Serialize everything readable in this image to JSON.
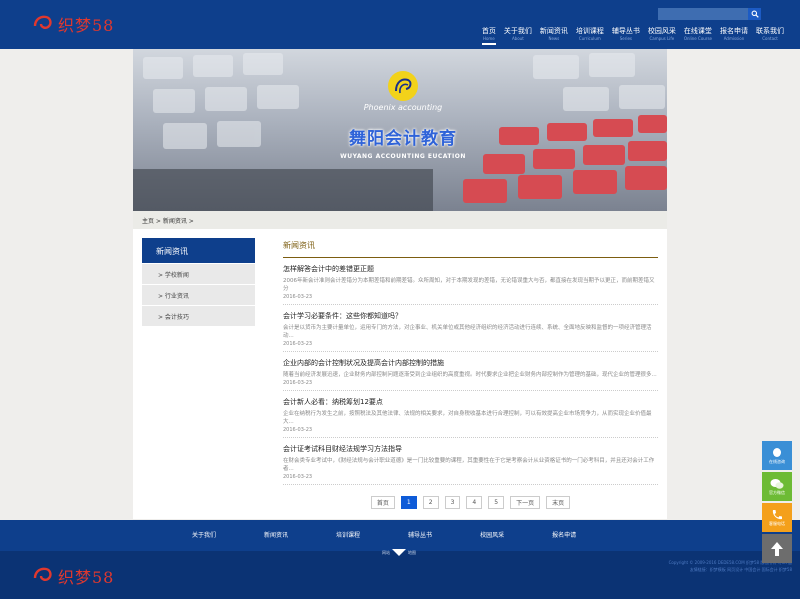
{
  "header": {
    "logo_text": "织梦58",
    "search_placeholder": "",
    "nav": [
      {
        "zh": "首页",
        "en": "Home"
      },
      {
        "zh": "关于我们",
        "en": "About"
      },
      {
        "zh": "新闻资讯",
        "en": "News"
      },
      {
        "zh": "培训课程",
        "en": "Curriculum"
      },
      {
        "zh": "辅导丛书",
        "en": "Series"
      },
      {
        "zh": "校园风采",
        "en": "Campus Life"
      },
      {
        "zh": "在线课堂",
        "en": "Online Course"
      },
      {
        "zh": "报名申请",
        "en": "Admission"
      },
      {
        "zh": "联系我们",
        "en": "Contact"
      }
    ]
  },
  "banner": {
    "brand_en": "Phoenix accounting",
    "title": "舞阳会计教育",
    "subtitle": "WUYANG ACCOUNTING EUCATION"
  },
  "breadcrumb": {
    "home": "主页",
    "sep1": " > ",
    "current": "新闻资讯",
    "sep2": " >"
  },
  "sidebar": {
    "title": "新闻资讯",
    "items": [
      "> 学校新闻",
      "> 行业资讯",
      "> 会计技巧"
    ]
  },
  "main": {
    "title": "新闻资讯",
    "articles": [
      {
        "title": "怎样解答会计中的差错更正题",
        "desc": "2006年新会计准则会计差错分为本期差错和前期差错。众所周知，对于本期发现的差错，无论错误重大与否，都直接在发现当期予以更正，而前期差错又分",
        "date": "2016-03-23"
      },
      {
        "title": "会计学习必要条件：这些你都知道吗？",
        "desc": "会计是以货币为主要计量单位，运用专门的方法，对企事业、机关单位或其他经济组织的经济活动进行连续、系统、全面地反映和监督的一项经济管理活动...",
        "date": "2016-03-23"
      },
      {
        "title": "企业内部的会计控制状况及提高会计内部控制的措施",
        "desc": "随着当前经济发展迅速，企业财务内部控制问题逐渐受到企业组织的高度重视。时代要求企业把企业财务内部控制作为管理的基础，现代企业的管理很多...",
        "date": "2016-03-23"
      },
      {
        "title": "会计新人必看：纳税筹划12要点",
        "desc": "企业在纳税行为发生之前，按照税法及其他法律、法规的相关要求，对自身税收基本进行合理控制，可以有效提高企业市场竞争力，从而实现企业价值最大...",
        "date": "2016-03-23"
      },
      {
        "title": "会计证考试科目财经法规学习方法指导",
        "desc": "在财会类专业考试中，《财经法规与会计职业道德》是一门比较重要的课程，其重要性在于它是考察会计从业资格证书的一门必考科目，并且还对会计工作者...",
        "date": "2016-03-23"
      }
    ],
    "pager": [
      "首页",
      "1",
      "2",
      "3",
      "4",
      "5",
      "下一页",
      "末页"
    ]
  },
  "footer": {
    "nav": [
      "关于我们",
      "新闻资讯",
      "培训课程",
      "辅导丛书",
      "校园风采",
      "报名申请"
    ],
    "logo_text": "织梦58",
    "mini_left": "网站",
    "mini_right": "地图",
    "copyright_1": "Copyright © 2009-2016 DEDE58.COM 织梦58 版权所有 粤ICP备",
    "copyright_2": "友情链接：织梦模板 网页设计 中国会计 国际会计 织梦58",
    "float": [
      "在线咨询",
      "官方微信",
      "客服电话"
    ]
  },
  "colors": {
    "primary": "#0e3f8c",
    "logo_red": "#e0382e",
    "accent": "#7c5d10",
    "pager_active": "#0e5bd8"
  }
}
